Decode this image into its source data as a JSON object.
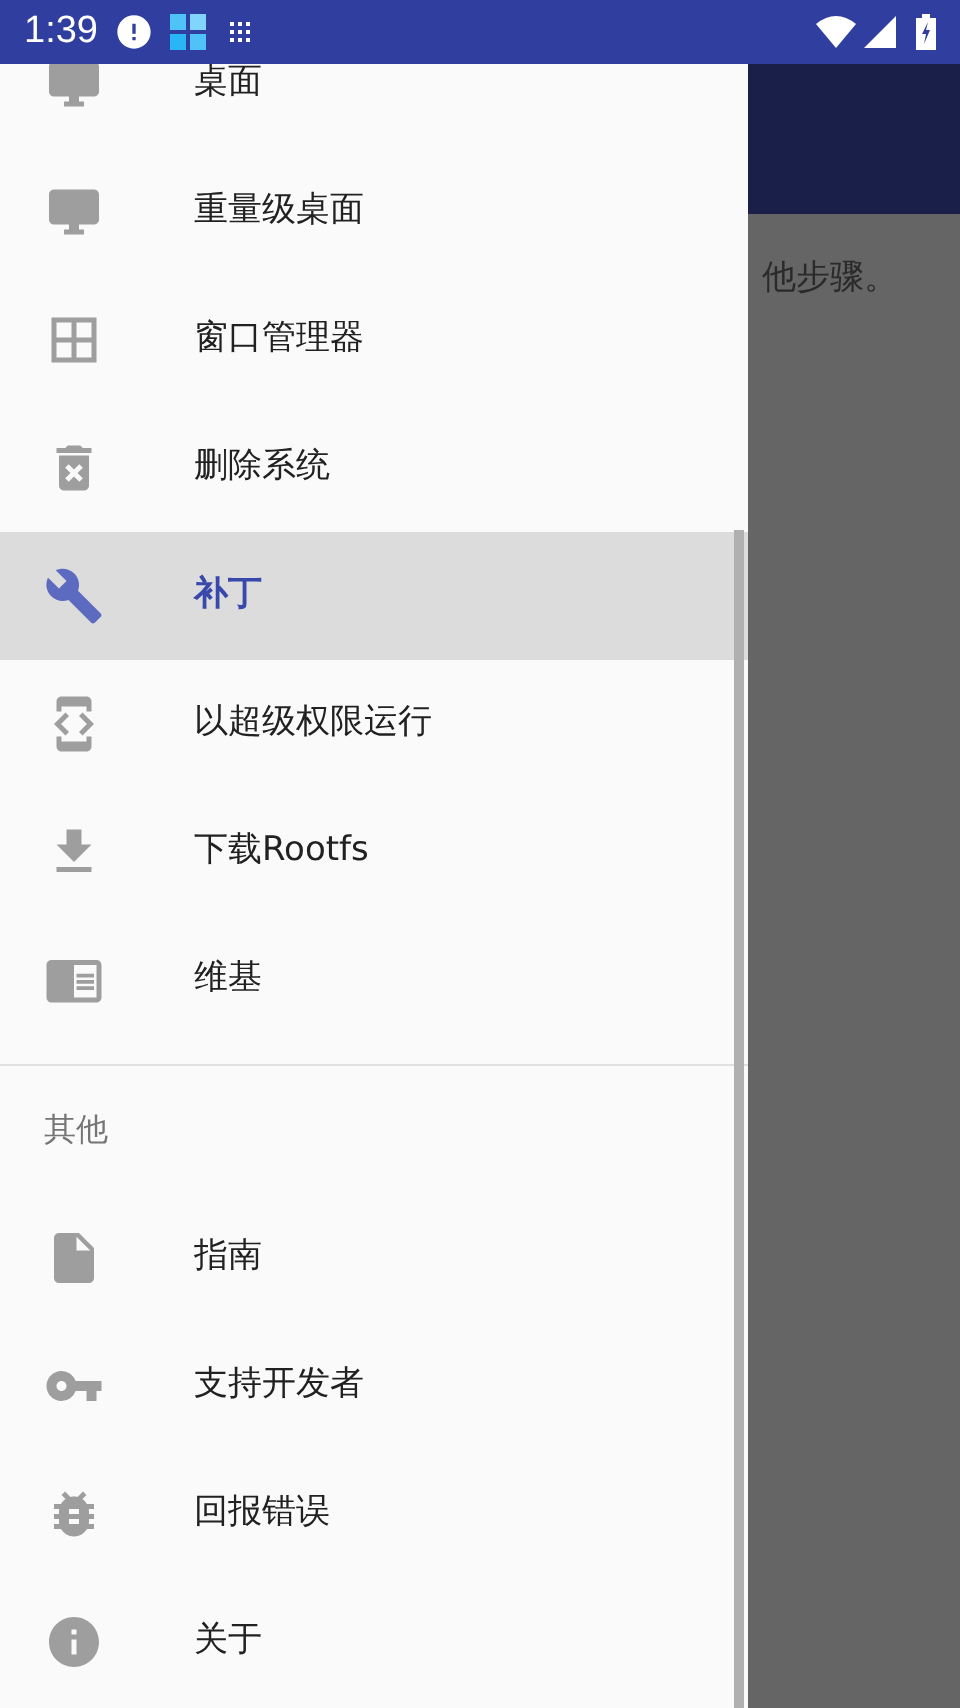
{
  "status_bar": {
    "time": "1:39"
  },
  "background": {
    "text": "他步骤。"
  },
  "drawer": {
    "sections": [
      {
        "items": [
          {
            "label": "桌面",
            "selected": false
          },
          {
            "label": "重量级桌面",
            "selected": false
          },
          {
            "label": "窗口管理器",
            "selected": false
          },
          {
            "label": "删除系统",
            "selected": false
          },
          {
            "label": "补丁",
            "selected": true
          },
          {
            "label": "以超级权限运行",
            "selected": false
          },
          {
            "label": "下载Rootfs",
            "selected": false
          },
          {
            "label": "维基",
            "selected": false
          }
        ]
      },
      {
        "header": "其他",
        "items": [
          {
            "label": "指南",
            "selected": false
          },
          {
            "label": "支持开发者",
            "selected": false
          },
          {
            "label": "回报错误",
            "selected": false
          },
          {
            "label": "关于",
            "selected": false
          }
        ]
      }
    ]
  }
}
